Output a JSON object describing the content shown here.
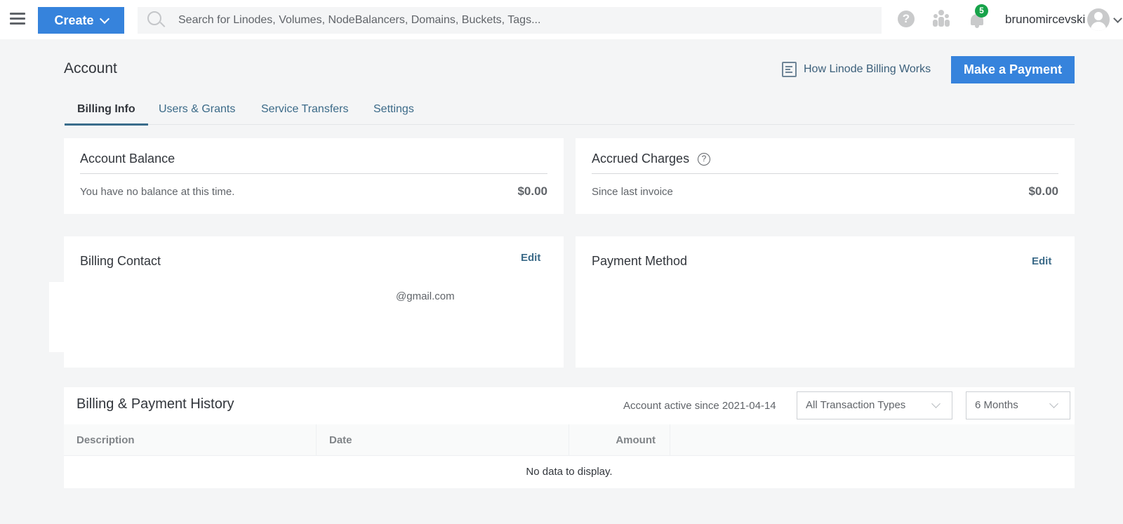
{
  "topbar": {
    "create_label": "Create",
    "search_placeholder": "Search for Linodes, Volumes, NodeBalancers, Domains, Buckets, Tags...",
    "help_glyph": "?",
    "notification_count": "5",
    "username": "brunomircevski",
    "icons": [
      "menu-icon",
      "chevron-down-icon",
      "search-icon",
      "help-icon",
      "community-icon",
      "bell-icon",
      "avatar-icon",
      "chevron-down-icon"
    ]
  },
  "header": {
    "title": "Account",
    "docs_link": "How Linode Billing Works",
    "payment_button": "Make a Payment"
  },
  "tabs": [
    {
      "label": "Billing Info",
      "active": true
    },
    {
      "label": "Users & Grants",
      "active": false
    },
    {
      "label": "Service Transfers",
      "active": false
    },
    {
      "label": "Settings",
      "active": false
    }
  ],
  "account_balance": {
    "title": "Account Balance",
    "description": "You have no balance at this time.",
    "amount": "$0.00"
  },
  "accrued_charges": {
    "title": "Accrued Charges",
    "help_glyph": "?",
    "description": "Since last invoice",
    "amount": "$0.00"
  },
  "billing_contact": {
    "title": "Billing Contact",
    "edit_label": "Edit",
    "email": "@gmail.com"
  },
  "payment_method": {
    "title": "Payment Method",
    "edit_label": "Edit"
  },
  "history": {
    "title": "Billing & Payment History",
    "active_since": "Account active since 2021-04-14",
    "transaction_type": "All Transaction Types",
    "period": "6 Months",
    "columns": [
      "Description",
      "Date",
      "Amount"
    ],
    "empty_message": "No data to display."
  },
  "colors": {
    "primary": "#3683dc",
    "link": "#3b6a88",
    "badge": "#17a34a",
    "background": "#f4f5f6"
  }
}
